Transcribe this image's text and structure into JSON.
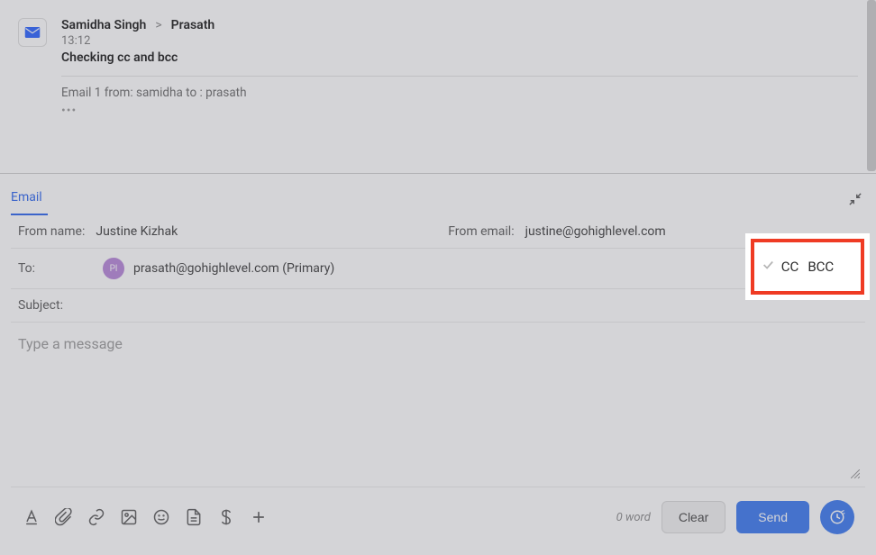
{
  "thread": {
    "from": "Samidha Singh",
    "to": "Prasath",
    "arrow": ">",
    "time": "13:12",
    "subject": "Checking cc and bcc",
    "preview": "Email 1 from: samidha to : prasath",
    "dots": "•••"
  },
  "composer": {
    "tab_label": "Email",
    "from_name_label": "From name:",
    "from_name_value": "Justine Kizhak",
    "from_email_label": "From email:",
    "from_email_value": "justine@gohighlevel.com",
    "to_label": "To:",
    "to_avatar": "Pl",
    "to_value": "prasath@gohighlevel.com (Primary)",
    "cc_label": "CC",
    "bcc_label": "BCC",
    "subject_label": "Subject:",
    "body_placeholder": "Type a message"
  },
  "footer": {
    "word_count": "0 word",
    "clear_label": "Clear",
    "send_label": "Send"
  },
  "highlight": {
    "cc": "CC",
    "bcc": "BCC"
  }
}
